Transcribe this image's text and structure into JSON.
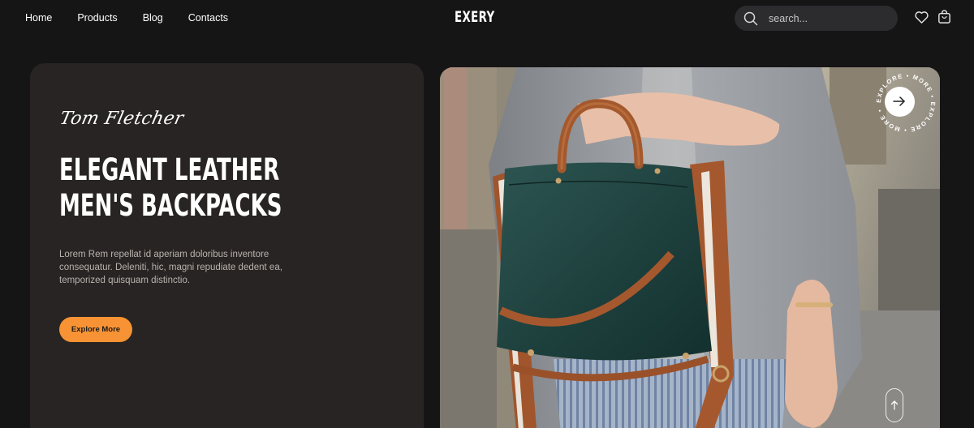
{
  "nav": {
    "links": [
      "Home",
      "Products",
      "Blog",
      "Contacts"
    ],
    "brand": "EXERY",
    "search_placeholder": "search...",
    "icons": [
      "search-icon",
      "heart-icon",
      "shopping-bag-icon"
    ]
  },
  "hero": {
    "author": "Tom Fletcher",
    "headline_lines": [
      "Elegant Leather",
      "Men's Backpacks"
    ],
    "description": "Lorem Rem repellat id aperiam doloribus inventore consequatur. Deleniti, hic, magni repudiate dedent ea, temporized quisquam distinctio.",
    "cta_label": "Explore More",
    "badge_text": "EXPLORE • MORE • EXPLORE • MORE •",
    "icons": [
      "arrow-right-icon",
      "arrow-up-icon"
    ]
  },
  "colors": {
    "background": "#161516",
    "card": "#282423",
    "accent": "#f79334",
    "search_bg": "#2c2b2d"
  }
}
